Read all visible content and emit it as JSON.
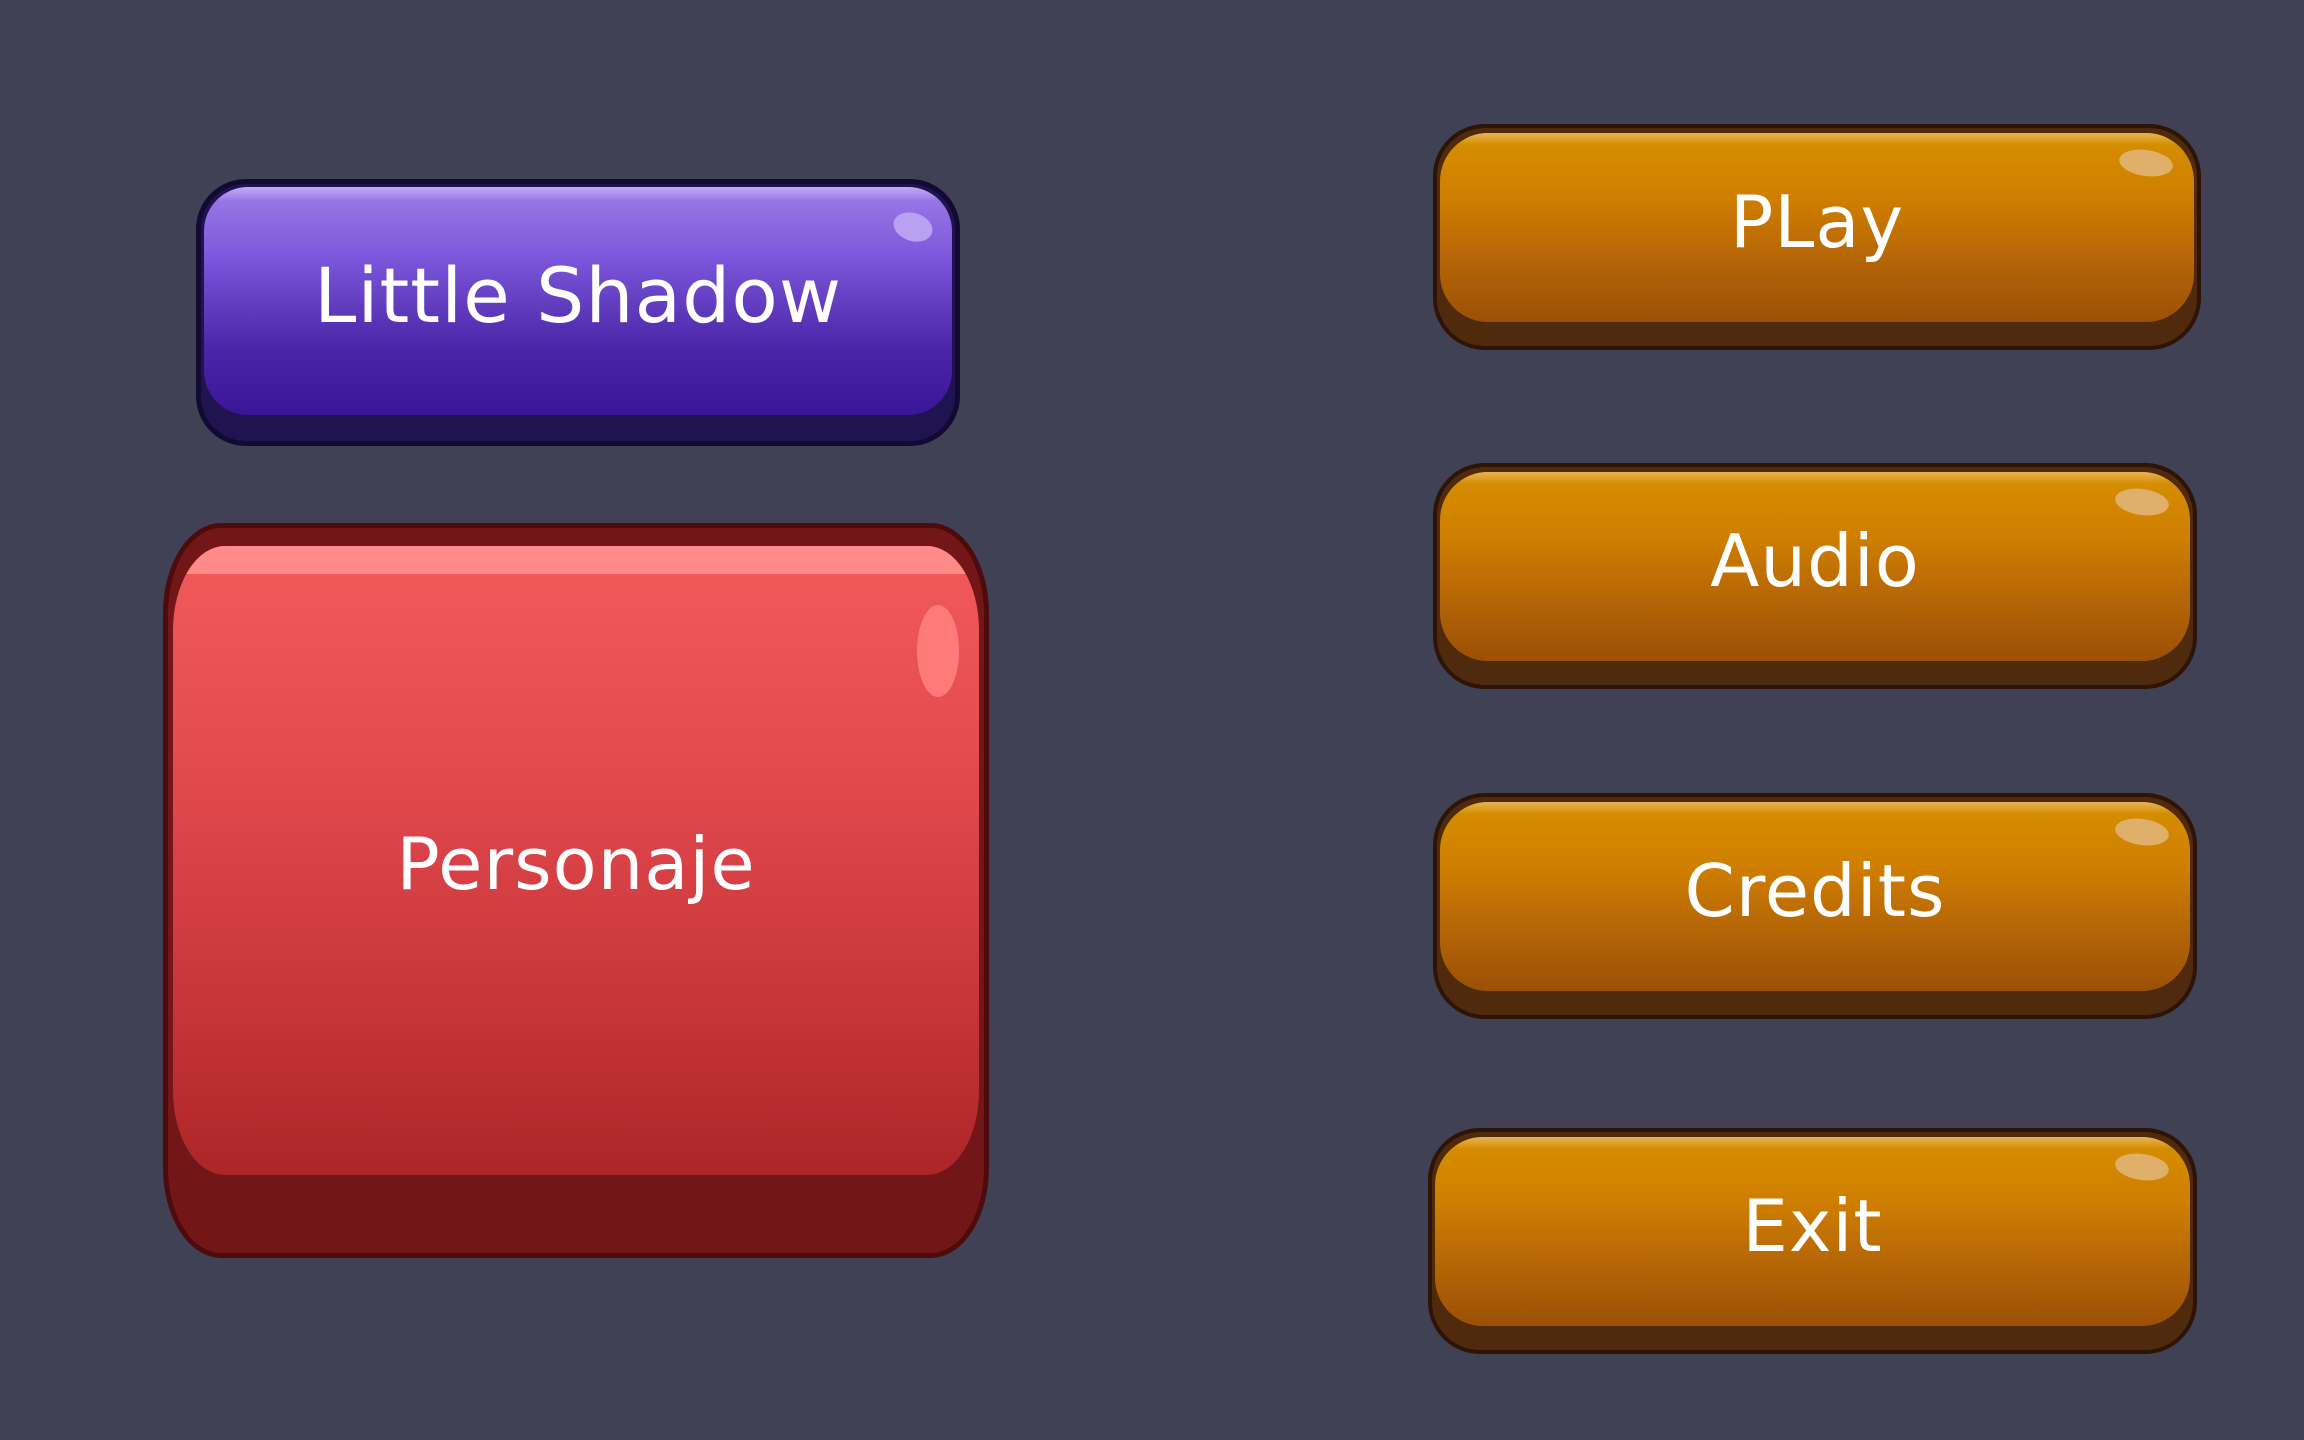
{
  "title_button": {
    "label": "Little Shadow"
  },
  "character_button": {
    "label": "Personaje"
  },
  "menu": {
    "items": [
      {
        "id": "play",
        "label": "PLay"
      },
      {
        "id": "audio",
        "label": "Audio"
      },
      {
        "id": "credits",
        "label": "Credits"
      },
      {
        "id": "exit",
        "label": "Exit"
      }
    ]
  },
  "colors": {
    "background": "#414155",
    "title_button": "#6a45cf",
    "character_button": "#d8413f",
    "menu_button": "#c87404",
    "text": "#ffffff"
  }
}
